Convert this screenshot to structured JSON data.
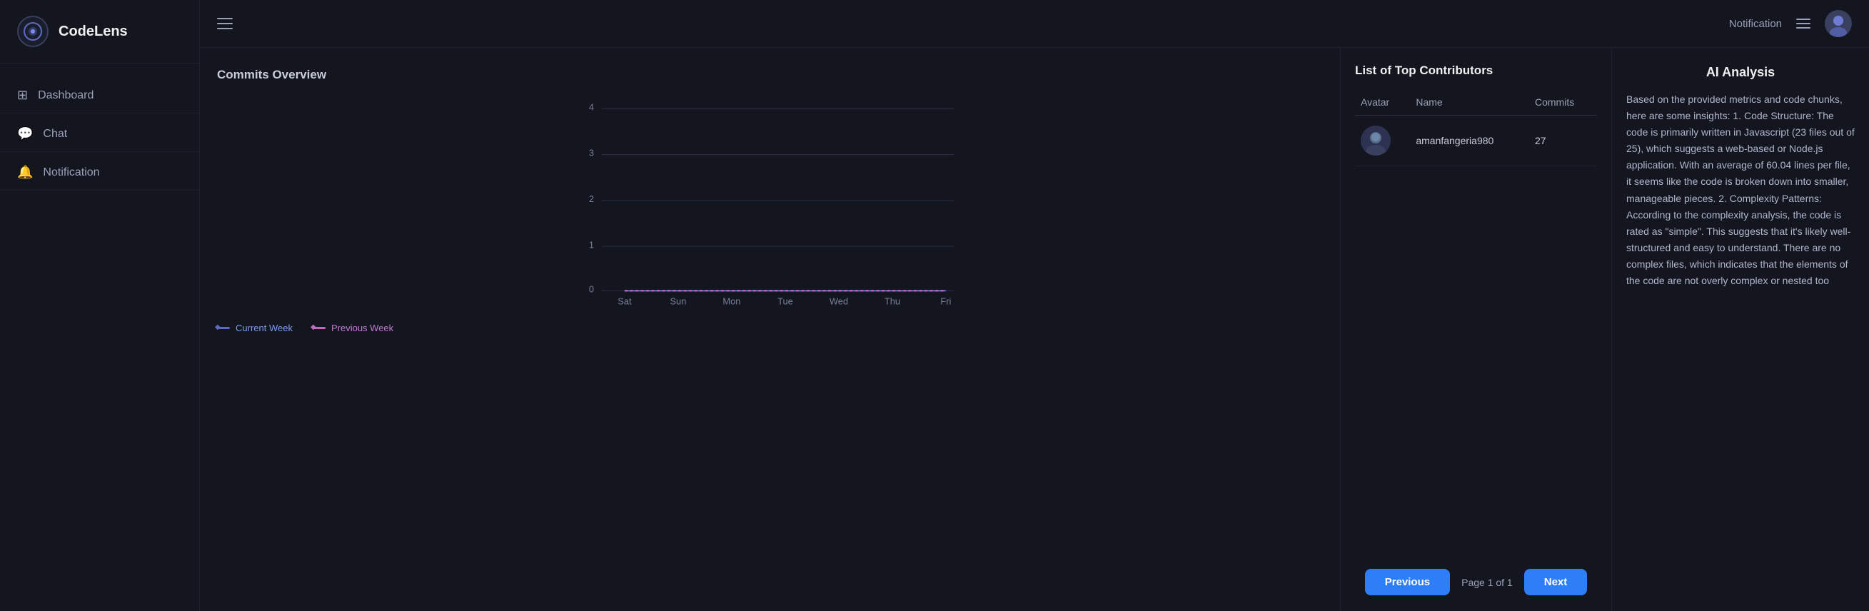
{
  "sidebar": {
    "logo": {
      "text": "CodeLens"
    },
    "nav_items": [
      {
        "id": "dashboard",
        "label": "Dashboard",
        "icon": "⊞"
      },
      {
        "id": "chat",
        "label": "Chat",
        "icon": "💬"
      },
      {
        "id": "notification",
        "label": "Notification",
        "icon": "🔔"
      }
    ]
  },
  "topbar": {
    "notification_label": "Notification"
  },
  "commits_panel": {
    "title": "Commits Overview",
    "chart": {
      "y_labels": [
        "4",
        "3",
        "2",
        "1",
        "0"
      ],
      "x_labels": [
        "Sat",
        "Sun",
        "Mon",
        "Tue",
        "Wed",
        "Thu",
        "Fri"
      ]
    },
    "legend": [
      {
        "id": "current_week",
        "label": "Current Week",
        "color": "#5c6bc0"
      },
      {
        "id": "previous_week",
        "label": "Previous Week",
        "color": "#c06bc0"
      }
    ]
  },
  "contributors_panel": {
    "title": "List of Top Contributors",
    "table": {
      "headers": [
        "Avatar",
        "Name",
        "Commits"
      ],
      "rows": [
        {
          "name": "amanfangeria980",
          "commits": "27"
        }
      ]
    },
    "pagination": {
      "previous_label": "Previous",
      "next_label": "Next",
      "page_info": "Page 1 of 1"
    }
  },
  "ai_panel": {
    "title": "AI Analysis",
    "text": "Based on the provided metrics and code chunks, here are some insights: 1. Code Structure: The code is primarily written in Javascript (23 files out of 25), which suggests a web-based or Node.js application. With an average of 60.04 lines per file, it seems like the code is broken down into smaller, manageable pieces. 2. Complexity Patterns: According to the complexity analysis, the code is rated as \"simple\". This suggests that it's likely well-structured and easy to understand. There are no complex files, which indicates that the elements of the code are not overly complex or nested too"
  }
}
